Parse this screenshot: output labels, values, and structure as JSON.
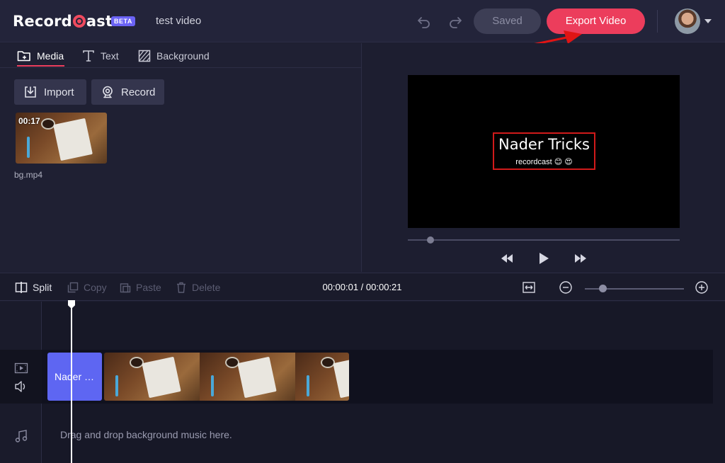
{
  "app": {
    "logo_text_left": "Record",
    "logo_text_right": "ast",
    "beta_badge": "BETA",
    "project_title": "test video"
  },
  "header": {
    "saved_label": "Saved",
    "export_label": "Export Video",
    "icons": [
      "undo-icon",
      "redo-icon",
      "avatar",
      "chevron-down-icon"
    ]
  },
  "media_panel": {
    "tabs": [
      {
        "label": "Media",
        "icon": "media-folder-icon",
        "active": true
      },
      {
        "label": "Text",
        "icon": "text-icon",
        "active": false
      },
      {
        "label": "Background",
        "icon": "background-icon",
        "active": false
      }
    ],
    "import_label": "Import",
    "record_label": "Record",
    "items": [
      {
        "name": "bg.mp4",
        "duration": "00:17"
      }
    ]
  },
  "preview": {
    "overlay_title": "Nader Tricks",
    "overlay_subtitle": "recordcast 😊 😍",
    "overlay_border_color": "#d11a1a"
  },
  "timeline_toolbar": {
    "split_label": "Split",
    "copy_label": "Copy",
    "paste_label": "Paste",
    "delete_label": "Delete",
    "timecode": "00:00:01 / 00:00:21"
  },
  "timeline": {
    "text_clip_label": "Nader …",
    "music_hint": "Drag and drop background music here."
  },
  "colors": {
    "accent": "#ec3d5c",
    "clip_text": "#5e66f2",
    "background": "#1d1e30"
  }
}
